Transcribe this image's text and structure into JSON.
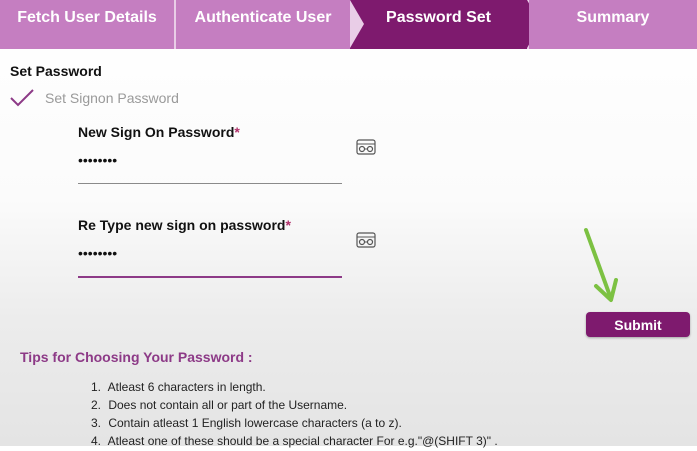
{
  "stepper": {
    "steps": [
      {
        "label": "Fetch User Details"
      },
      {
        "label": "Authenticate User"
      },
      {
        "label": "Password Set"
      },
      {
        "label": "Summary"
      }
    ]
  },
  "section": {
    "title": "Set Password",
    "substep": "Set Signon Password"
  },
  "form": {
    "new_password": {
      "label": "New Sign On Password",
      "required_mark": "*",
      "value": "••••••••"
    },
    "retype_password": {
      "label": "Re Type new sign on password",
      "required_mark": "*",
      "value": "••••••••"
    }
  },
  "submit_label": "Submit",
  "tips": {
    "title": "Tips for Choosing Your Password :",
    "items": [
      {
        "num": "1.",
        "text": "Atleast 6 characters in length."
      },
      {
        "num": "2.",
        "text": "Does not contain all or part of the Username."
      },
      {
        "num": "3.",
        "text": "Contain atleast 1 English lowercase characters (a to z)."
      },
      {
        "num": "4.",
        "text": "Atleast one of these should be a special character For e.g.\"@(SHIFT 3)\" ."
      }
    ]
  },
  "colors": {
    "step_inactive": "#c57ec1",
    "step_active": "#7e1a6e",
    "accent": "#8d3a87",
    "annotation_arrow": "#7cc142"
  },
  "icons": {
    "check": "check-icon",
    "toggle_visibility": "eye-toggle-icon",
    "annotation": "arrow-down-icon"
  }
}
